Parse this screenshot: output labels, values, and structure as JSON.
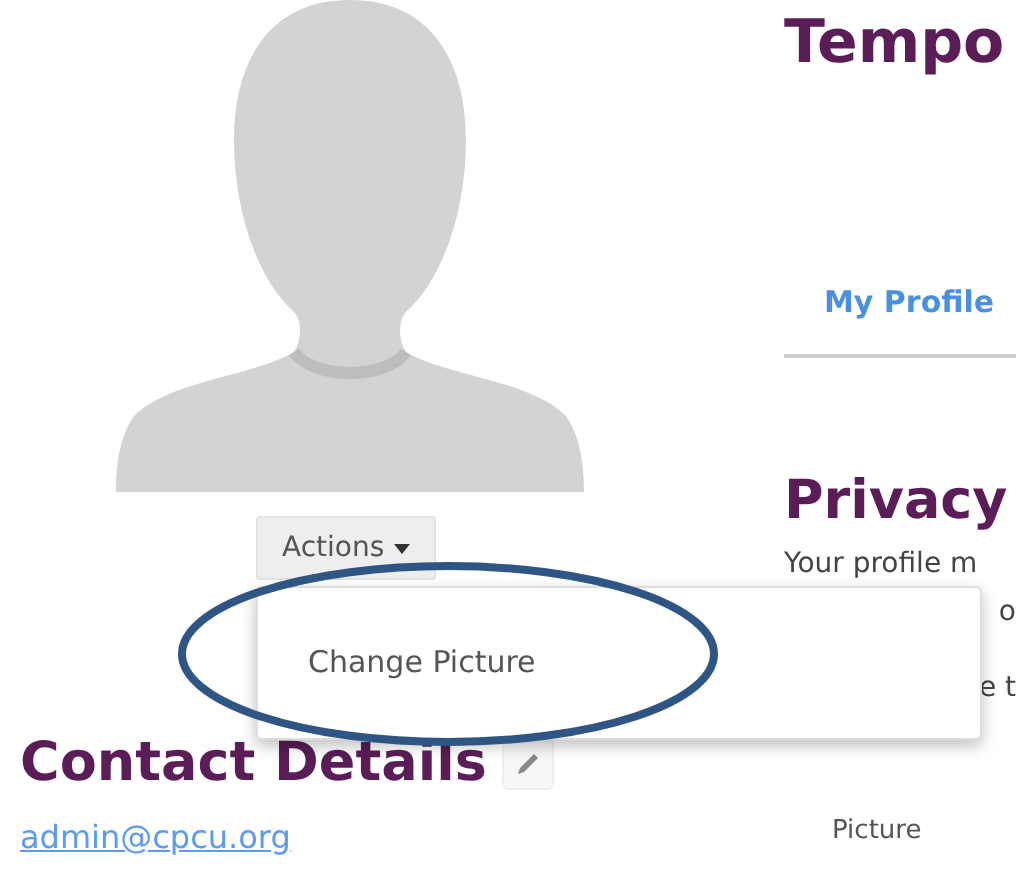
{
  "profile": {
    "actions_button": "Actions",
    "menu": {
      "items": [
        {
          "label": "Change Picture"
        }
      ]
    },
    "contact_heading": "Contact Details",
    "email": "admin@cpcu.org"
  },
  "main": {
    "title": "Tempo",
    "tabs": [
      {
        "label": "My Profile",
        "selected": true
      }
    ],
    "privacy_heading": "Privacy",
    "privacy_lines": [
      "Your profile m",
      "o",
      "e t"
    ],
    "field_label": "Picture"
  }
}
